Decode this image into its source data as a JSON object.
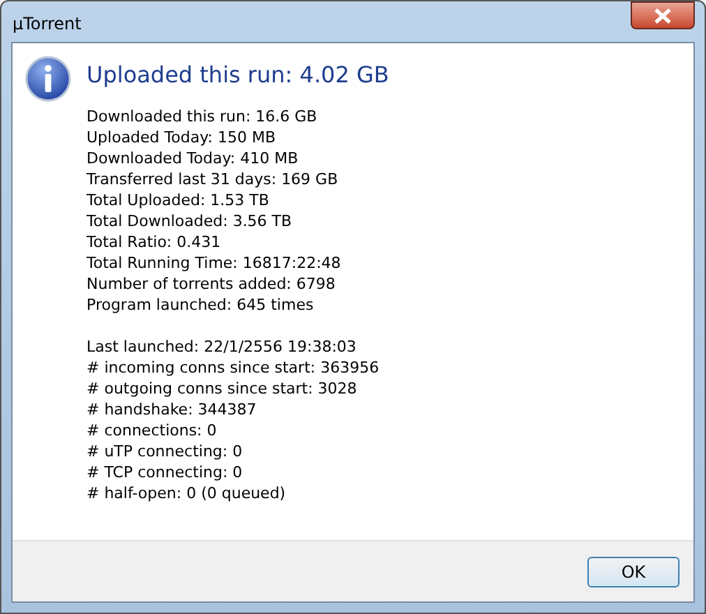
{
  "window": {
    "title": "µTorrent"
  },
  "heading": "Uploaded this run: 4.02 GB",
  "stat_groups": [
    [
      "Downloaded this run: 16.6 GB",
      "Uploaded Today: 150 MB",
      "Downloaded Today: 410 MB",
      "Transferred last 31 days: 169 GB",
      "Total Uploaded: 1.53 TB",
      "Total Downloaded: 3.56 TB",
      "Total Ratio: 0.431",
      "Total Running Time: 16817:22:48",
      "Number of torrents added: 6798",
      "Program launched: 645 times"
    ],
    [
      "Last launched: 22/1/2556 19:38:03",
      "# incoming conns since start: 363956",
      "# outgoing conns since start: 3028",
      "# handshake: 344387",
      "# connections: 0",
      "# uTP connecting: 0",
      "# TCP connecting: 0",
      "# half-open: 0 (0 queued)"
    ]
  ],
  "buttons": [
    "OK"
  ]
}
